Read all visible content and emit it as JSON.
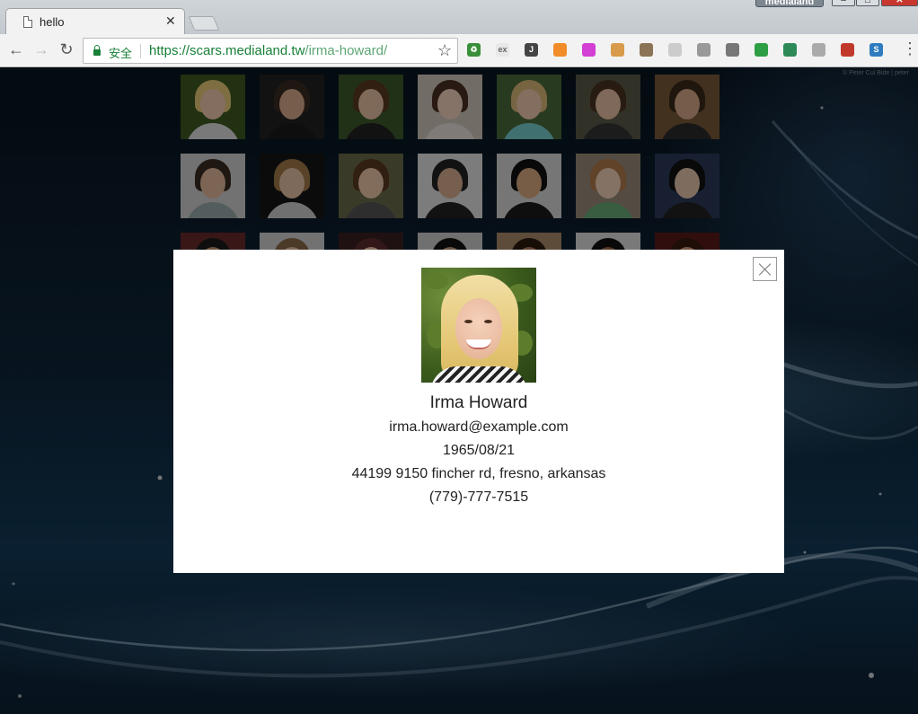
{
  "browser": {
    "tab_title": "hello",
    "tab_close": "✕",
    "profile_name": "medialand",
    "secure_label": "安全",
    "url_host": "https://scars.medialand.tw",
    "url_path": "/irma-howard/",
    "extensions": [
      {
        "name": "ext-icon-1",
        "color": "#3a8f3a",
        "glyph": "♻"
      },
      {
        "name": "ext-icon-2",
        "color": "#e8e8e8",
        "glyph": "ex"
      },
      {
        "name": "ext-icon-3",
        "color": "#444444",
        "glyph": "J"
      },
      {
        "name": "ext-icon-4",
        "color": "#f28c28",
        "glyph": ""
      },
      {
        "name": "ext-icon-5",
        "color": "#d23fd2",
        "glyph": ""
      },
      {
        "name": "ext-icon-6",
        "color": "#d89b4b",
        "glyph": ""
      },
      {
        "name": "ext-icon-7",
        "color": "#8b7355",
        "glyph": ""
      },
      {
        "name": "ext-icon-8",
        "color": "#cccccc",
        "glyph": ""
      },
      {
        "name": "ext-icon-9",
        "color": "#999999",
        "glyph": ""
      },
      {
        "name": "ext-icon-10",
        "color": "#777777",
        "glyph": ""
      },
      {
        "name": "ext-icon-11",
        "color": "#2e9e44",
        "glyph": ""
      },
      {
        "name": "ext-icon-12",
        "color": "#2d8a56",
        "glyph": ""
      },
      {
        "name": "ext-icon-13",
        "color": "#aaaaaa",
        "glyph": ""
      },
      {
        "name": "ext-icon-14",
        "color": "#c0392b",
        "glyph": ""
      },
      {
        "name": "ext-icon-15",
        "color": "#2f7bbf",
        "glyph": "S"
      }
    ]
  },
  "page": {
    "credit": "© Peter Cui Bide | peter"
  },
  "gallery": {
    "people": [
      {
        "name": "person-1",
        "bg": "#3d5a22",
        "hair": "#e6c978",
        "skin": "#f0c8ae",
        "shirt": "#ddd"
      },
      {
        "name": "person-2",
        "bg": "#222222",
        "hair": "#3a2b22",
        "skin": "#d9a98a",
        "shirt": "#1a1a1a"
      },
      {
        "name": "person-3",
        "bg": "#3c5a2c",
        "hair": "#5a3a22",
        "skin": "#e8bfa0",
        "shirt": "#222"
      },
      {
        "name": "person-4",
        "bg": "#cfc5bc",
        "hair": "#4a2f22",
        "skin": "#f2d1bd",
        "shirt": "#e6e0da"
      },
      {
        "name": "person-5",
        "bg": "#4a6a3a",
        "hair": "#d9b878",
        "skin": "#eec9ad",
        "shirt": "#7cc"
      },
      {
        "name": "person-6",
        "bg": "#5a5a4a",
        "hair": "#4a3322",
        "skin": "#e8c0a4",
        "shirt": "#333"
      },
      {
        "name": "person-7",
        "bg": "#7a5a3a",
        "hair": "#3a2a1a",
        "skin": "#d8a888",
        "shirt": "#2a2a2a"
      },
      {
        "name": "person-8",
        "bg": "#cfcfcf",
        "hair": "#3a2a20",
        "skin": "#e2b89c",
        "shirt": "#9aa"
      },
      {
        "name": "person-9",
        "bg": "#151515",
        "hair": "#a07a4a",
        "skin": "#e6c2a4",
        "shirt": "#ccc"
      },
      {
        "name": "person-10",
        "bg": "#6a6a4a",
        "hair": "#5a3a22",
        "skin": "#edc6aa",
        "shirt": "#555"
      },
      {
        "name": "person-11",
        "bg": "#e2e2e2",
        "hair": "#222",
        "skin": "#d9ae90",
        "shirt": "#222"
      },
      {
        "name": "person-12",
        "bg": "#d8d8d8",
        "hair": "#111",
        "skin": "#d9a97e",
        "shirt": "#1a1a1a"
      },
      {
        "name": "person-13",
        "bg": "#9a8a7a",
        "hair": "#b07a4a",
        "skin": "#f0d0b8",
        "shirt": "#6a7"
      },
      {
        "name": "person-14",
        "bg": "#2a3a5a",
        "hair": "#111",
        "skin": "#e6c6ae",
        "shirt": "#222"
      },
      {
        "name": "person-15",
        "bg": "#6a2a2a",
        "hair": "#1a1a1a",
        "skin": "#c49470",
        "shirt": "#444"
      },
      {
        "name": "person-16",
        "bg": "#cfcfcf",
        "hair": "#8a6a4a",
        "skin": "#e8c0a4",
        "shirt": "#888"
      },
      {
        "name": "person-17",
        "bg": "#3a2020",
        "hair": "#5a2a2a",
        "skin": "#f0c8b0",
        "shirt": "#333"
      },
      {
        "name": "person-18",
        "bg": "#cccccc",
        "hair": "#111",
        "skin": "#c49a7a",
        "shirt": "#444"
      },
      {
        "name": "person-19",
        "bg": "#aa8a6a",
        "hair": "#2a1a10",
        "skin": "#b07a5a",
        "shirt": "#555"
      },
      {
        "name": "person-20",
        "bg": "#dddddd",
        "hair": "#111",
        "skin": "#9a6a4a",
        "shirt": "#333"
      },
      {
        "name": "person-21",
        "bg": "#5a1a1a",
        "hair": "#3a1a10",
        "skin": "#d49a7a",
        "shirt": "#2a2a2a"
      },
      {
        "name": "person-22",
        "bg": "#3a2a20",
        "hair": "#2a1a10",
        "skin": "#c08a6a",
        "shirt": "#111"
      },
      {
        "name": "person-23",
        "bg": "#4a3a3a",
        "hair": "#1a1010",
        "skin": "#5a3a28",
        "shirt": "#d8c8b8"
      },
      {
        "name": "person-24",
        "bg": "#5a4a3a",
        "hair": "#3a2010",
        "skin": "#c89878",
        "shirt": "#aa4444"
      },
      {
        "name": "person-25",
        "bg": "#6a3a4a",
        "hair": "#3a1a22",
        "skin": "#e0b8a0",
        "shirt": "#222"
      },
      {
        "name": "person-26",
        "bg": "#3a2a2a",
        "hair": "#2a1010",
        "skin": "#e8c4ac",
        "shirt": "#222"
      },
      {
        "name": "person-27",
        "bg": "#2a3a6a",
        "hair": "#3a2a1a",
        "skin": "#ecc8b0",
        "shirt": "#22306a"
      },
      {
        "name": "person-28",
        "bg": "#3a1a1a",
        "hair": "#aa6a2a",
        "skin": "#e8b898",
        "shirt": "#d04a18"
      },
      {
        "name": "person-29",
        "bg": "#4a4a3a",
        "hair": "#1a1a1a",
        "skin": "#c8987a",
        "shirt": "#333"
      }
    ]
  },
  "profile": {
    "name": "Irma Howard",
    "email": "irma.howard@example.com",
    "dob": "1965/08/21",
    "address": "44199 9150 fincher rd, fresno, arkansas",
    "phone": "(779)-777-7515"
  }
}
